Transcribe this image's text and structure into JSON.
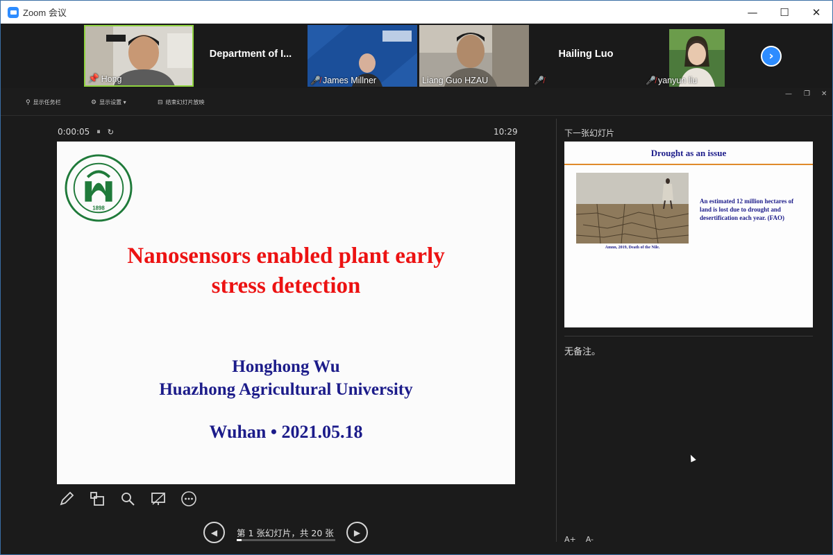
{
  "window": {
    "title": "Zoom 会议",
    "icon": "zoom-logo-icon",
    "controls": {
      "minimize": "—",
      "maximize": "☐",
      "close": "✕"
    }
  },
  "participants": [
    {
      "name": "Hong",
      "type": "video",
      "active": true,
      "pinned": true
    },
    {
      "name": "Department of I...",
      "type": "name-only"
    },
    {
      "name": "James Millner",
      "type": "video",
      "muted": true
    },
    {
      "name": "Liang Guo HZAU",
      "type": "video"
    },
    {
      "name": "Hailing Luo",
      "type": "name-only",
      "muted": true
    },
    {
      "name": "yanyun liu",
      "type": "video",
      "muted": true
    }
  ],
  "presenter_toolbar": {
    "taskbar_label": "显示任务栏",
    "display_settings_label": "显示设置 ▾",
    "end_show_label": "结束幻灯片放映"
  },
  "slide_view": {
    "elapsed": "0:00:05",
    "pause_icon": "⏸",
    "reset_icon": "↻",
    "clock": "10:29",
    "current_slide": {
      "title_line1": "Nanosensors enabled plant early",
      "title_line2": "stress detection",
      "author": "Honghong Wu",
      "affiliation": "Huazhong Agricultural University",
      "place_date": "Wuhan • 2021.05.18",
      "logo_year": "1898"
    },
    "slide_count": "第 1 张幻灯片，共 20 张",
    "progress_fraction": 0.05
  },
  "next_panel": {
    "label": "下一张幻灯片",
    "next_slide": {
      "title": "Drought as an issue",
      "text": "An estimated 12 million hectares of land is lost due to drought and desertification each year.  (FAO)",
      "caption": "Amnn, 2019, Death of the Nile."
    },
    "notes": "无备注。",
    "font_increase": "A+",
    "font_decrease": "A-"
  },
  "colors": {
    "accent": "#2d8cff",
    "active_border": "#8fd33f",
    "title_red": "#ec1212",
    "navy": "#1c1c8a",
    "logo_green": "#1f7a3a"
  }
}
